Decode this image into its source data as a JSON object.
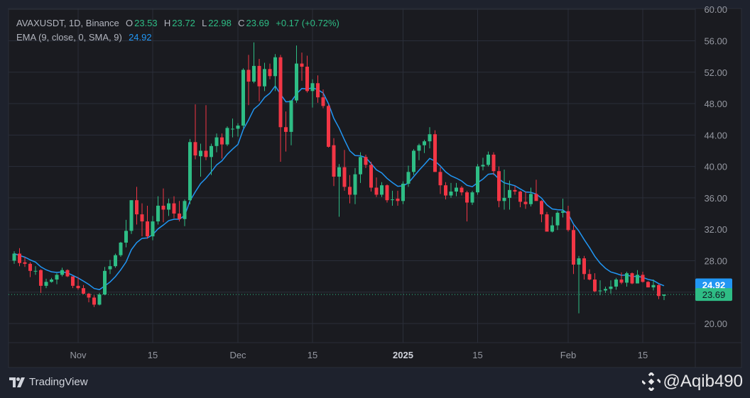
{
  "legend": {
    "symbol": "AVAXUSDT, 1D, Binance",
    "o_label": "O",
    "o": "23.53",
    "h_label": "H",
    "h": "23.72",
    "l_label": "L",
    "l": "22.98",
    "c_label": "C",
    "c": "23.69",
    "change": "+0.17 (+0.72%)",
    "indicator": "EMA (9, close, 0, SMA, 9)",
    "indicator_value": "24.92"
  },
  "footer": {
    "brand": "TradingView",
    "watermark": "@Aqib490"
  },
  "colors": {
    "up": "#2ebd85",
    "down": "#f23645",
    "ema": "#2196f3",
    "bg": "#1a1b20",
    "grid": "#2a2e39"
  },
  "chart_data": {
    "type": "candlestick",
    "title": "AVAXUSDT, 1D, Binance",
    "start_date": "2024-10-20",
    "ylim": [
      18.5,
      60
    ],
    "y_ticks": [
      "20.00",
      "24.00",
      "28.00",
      "32.00",
      "36.00",
      "40.00",
      "44.00",
      "48.00",
      "52.00",
      "56.00",
      "60.00"
    ],
    "x_ticks": [
      {
        "label": "Nov",
        "day": 12
      },
      {
        "label": "15",
        "day": 26
      },
      {
        "label": "Dec",
        "day": 42
      },
      {
        "label": "15",
        "day": 56
      },
      {
        "label": "2025",
        "day": 73,
        "bold": true
      },
      {
        "label": "15",
        "day": 87
      },
      {
        "label": "Feb",
        "day": 104
      },
      {
        "label": "15",
        "day": 118
      }
    ],
    "price_labels": [
      {
        "value": "24.92",
        "kind": "ema"
      },
      {
        "value": "23.69",
        "kind": "last"
      }
    ],
    "last_price": 23.69,
    "ema_period": 9,
    "ohlc": [
      [
        28.0,
        29.2,
        27.6,
        28.9
      ],
      [
        28.9,
        29.6,
        27.3,
        27.7
      ],
      [
        27.8,
        28.5,
        27.2,
        27.6
      ],
      [
        27.6,
        27.8,
        25.9,
        26.7
      ],
      [
        26.7,
        27.3,
        26.2,
        26.7
      ],
      [
        26.8,
        26.9,
        23.9,
        24.8
      ],
      [
        24.8,
        25.7,
        24.5,
        25.3
      ],
      [
        25.3,
        25.8,
        25.2,
        25.6
      ],
      [
        25.6,
        26.4,
        25.0,
        26.2
      ],
      [
        26.2,
        27.1,
        26.0,
        26.8
      ],
      [
        26.8,
        26.9,
        25.9,
        26.0
      ],
      [
        26.0,
        26.0,
        24.5,
        24.8
      ],
      [
        24.8,
        25.9,
        24.3,
        24.5
      ],
      [
        24.5,
        24.9,
        23.7,
        23.8
      ],
      [
        23.8,
        23.9,
        22.7,
        23.3
      ],
      [
        23.3,
        23.6,
        22.1,
        22.4
      ],
      [
        22.4,
        23.9,
        22.3,
        23.7
      ],
      [
        23.7,
        27.2,
        23.6,
        26.7
      ],
      [
        26.9,
        28.1,
        26.3,
        27.3
      ],
      [
        27.3,
        28.9,
        27.1,
        28.7
      ],
      [
        28.7,
        30.4,
        28.5,
        30.3
      ],
      [
        30.3,
        33.2,
        29.7,
        31.8
      ],
      [
        31.8,
        35.7,
        31.4,
        35.7
      ],
      [
        35.7,
        37.4,
        32.6,
        33.9
      ],
      [
        33.9,
        35.3,
        31.1,
        33.0
      ],
      [
        33.0,
        35.0,
        30.8,
        31.1
      ],
      [
        31.1,
        33.7,
        30.6,
        33.0
      ],
      [
        33.0,
        36.2,
        32.6,
        35.0
      ],
      [
        35.0,
        37.2,
        32.9,
        34.5
      ],
      [
        34.5,
        35.9,
        33.7,
        35.3
      ],
      [
        35.3,
        36.2,
        33.4,
        34.0
      ],
      [
        34.0,
        35.6,
        33.0,
        33.3
      ],
      [
        33.3,
        35.8,
        32.4,
        35.6
      ],
      [
        35.7,
        43.5,
        35.2,
        43.1
      ],
      [
        43.1,
        47.9,
        40.9,
        41.4
      ],
      [
        41.3,
        42.9,
        38.7,
        42.0
      ],
      [
        42.0,
        47.8,
        40.8,
        41.2
      ],
      [
        41.2,
        42.9,
        38.9,
        42.6
      ],
      [
        42.6,
        44.2,
        41.8,
        43.7
      ],
      [
        43.7,
        44.2,
        41.0,
        42.8
      ],
      [
        42.8,
        45.1,
        42.6,
        44.9
      ],
      [
        44.8,
        46.1,
        43.7,
        44.8
      ],
      [
        44.8,
        45.5,
        43.8,
        45.2
      ],
      [
        45.2,
        52.5,
        44.9,
        52.3
      ],
      [
        52.3,
        54.2,
        47.8,
        50.8
      ],
      [
        50.8,
        55.8,
        50.6,
        52.8
      ],
      [
        52.8,
        53.7,
        48.3,
        50.2
      ],
      [
        50.2,
        53.2,
        49.6,
        52.4
      ],
      [
        52.4,
        53.1,
        51.1,
        51.5
      ],
      [
        51.5,
        54.3,
        49.6,
        53.9
      ],
      [
        53.9,
        54.2,
        40.6,
        45.0
      ],
      [
        45.0,
        47.0,
        41.9,
        44.4
      ],
      [
        44.4,
        48.4,
        42.7,
        48.4
      ],
      [
        48.4,
        55.4,
        48.1,
        53.1
      ],
      [
        53.1,
        54.5,
        50.9,
        52.7
      ],
      [
        52.7,
        54.1,
        49.4,
        49.6
      ],
      [
        49.6,
        51.1,
        47.5,
        50.6
      ],
      [
        50.6,
        51.6,
        48.1,
        48.8
      ],
      [
        48.8,
        49.8,
        47.4,
        47.7
      ],
      [
        47.7,
        47.9,
        42.4,
        42.5
      ],
      [
        42.7,
        43.6,
        37.5,
        38.7
      ],
      [
        38.7,
        40.3,
        33.6,
        39.9
      ],
      [
        39.9,
        42.1,
        36.9,
        37.4
      ],
      [
        37.4,
        38.9,
        35.3,
        36.4
      ],
      [
        36.4,
        39.8,
        35.2,
        39.0
      ],
      [
        39.0,
        41.8,
        37.9,
        41.2
      ],
      [
        41.2,
        41.5,
        39.8,
        40.2
      ],
      [
        40.2,
        40.6,
        36.8,
        37.3
      ],
      [
        37.3,
        38.6,
        36.1,
        36.4
      ],
      [
        36.4,
        38.0,
        36.1,
        37.6
      ],
      [
        37.6,
        37.7,
        35.4,
        35.7
      ],
      [
        35.8,
        36.9,
        35.0,
        35.8
      ],
      [
        35.9,
        36.9,
        35.0,
        35.6
      ],
      [
        35.6,
        38.1,
        35.2,
        37.8
      ],
      [
        37.8,
        40.1,
        37.4,
        39.3
      ],
      [
        39.3,
        42.2,
        38.9,
        42.0
      ],
      [
        42.0,
        42.9,
        40.8,
        42.7
      ],
      [
        42.7,
        43.4,
        41.7,
        43.2
      ],
      [
        43.2,
        45.0,
        42.3,
        44.1
      ],
      [
        44.1,
        44.6,
        39.3,
        39.3
      ],
      [
        39.3,
        39.9,
        36.5,
        37.6
      ],
      [
        37.6,
        38.0,
        35.8,
        36.3
      ],
      [
        36.3,
        37.9,
        36.0,
        36.8
      ],
      [
        36.8,
        37.9,
        36.2,
        37.3
      ],
      [
        37.3,
        37.5,
        36.3,
        36.7
      ],
      [
        36.7,
        36.9,
        33.0,
        35.4
      ],
      [
        35.4,
        36.9,
        35.1,
        36.7
      ],
      [
        36.7,
        40.3,
        36.4,
        40.0
      ],
      [
        40.0,
        41.1,
        39.5,
        40.2
      ],
      [
        40.2,
        41.9,
        40.0,
        41.5
      ],
      [
        41.5,
        41.8,
        38.9,
        39.4
      ],
      [
        39.4,
        40.0,
        34.8,
        35.6
      ],
      [
        35.6,
        39.6,
        34.5,
        36.0
      ],
      [
        36.0,
        38.2,
        34.5,
        37.0
      ],
      [
        37.0,
        37.5,
        36.4,
        36.8
      ],
      [
        36.8,
        36.9,
        34.8,
        35.5
      ],
      [
        35.5,
        36.8,
        34.6,
        35.2
      ],
      [
        35.2,
        37.3,
        34.9,
        36.5
      ],
      [
        36.5,
        38.3,
        35.9,
        35.6
      ],
      [
        35.6,
        35.7,
        32.9,
        33.9
      ],
      [
        33.9,
        34.2,
        31.7,
        31.7
      ],
      [
        31.7,
        33.6,
        31.6,
        32.5
      ],
      [
        32.5,
        34.3,
        31.9,
        34.1
      ],
      [
        34.1,
        35.9,
        33.5,
        34.3
      ],
      [
        34.3,
        35.0,
        31.7,
        31.9
      ],
      [
        31.9,
        32.5,
        26.3,
        27.5
      ],
      [
        27.5,
        28.6,
        21.3,
        28.3
      ],
      [
        28.3,
        28.6,
        25.6,
        26.3
      ],
      [
        26.3,
        26.9,
        25.5,
        25.6
      ],
      [
        25.6,
        26.4,
        24.0,
        24.1
      ],
      [
        24.2,
        25.5,
        23.6,
        24.2
      ],
      [
        24.2,
        24.7,
        23.9,
        24.4
      ],
      [
        24.4,
        25.5,
        23.8,
        24.7
      ],
      [
        24.7,
        25.8,
        24.3,
        25.6
      ],
      [
        25.6,
        26.5,
        25.0,
        25.2
      ],
      [
        25.2,
        26.6,
        24.7,
        26.4
      ],
      [
        26.4,
        26.5,
        25.0,
        25.1
      ],
      [
        25.1,
        26.8,
        25.1,
        26.2
      ],
      [
        26.2,
        26.6,
        25.2,
        25.3
      ],
      [
        25.3,
        25.4,
        24.6,
        24.6
      ],
      [
        24.6,
        25.6,
        24.2,
        24.9
      ],
      [
        24.9,
        25.0,
        23.1,
        23.5
      ],
      [
        23.53,
        23.72,
        22.98,
        23.69
      ]
    ]
  }
}
